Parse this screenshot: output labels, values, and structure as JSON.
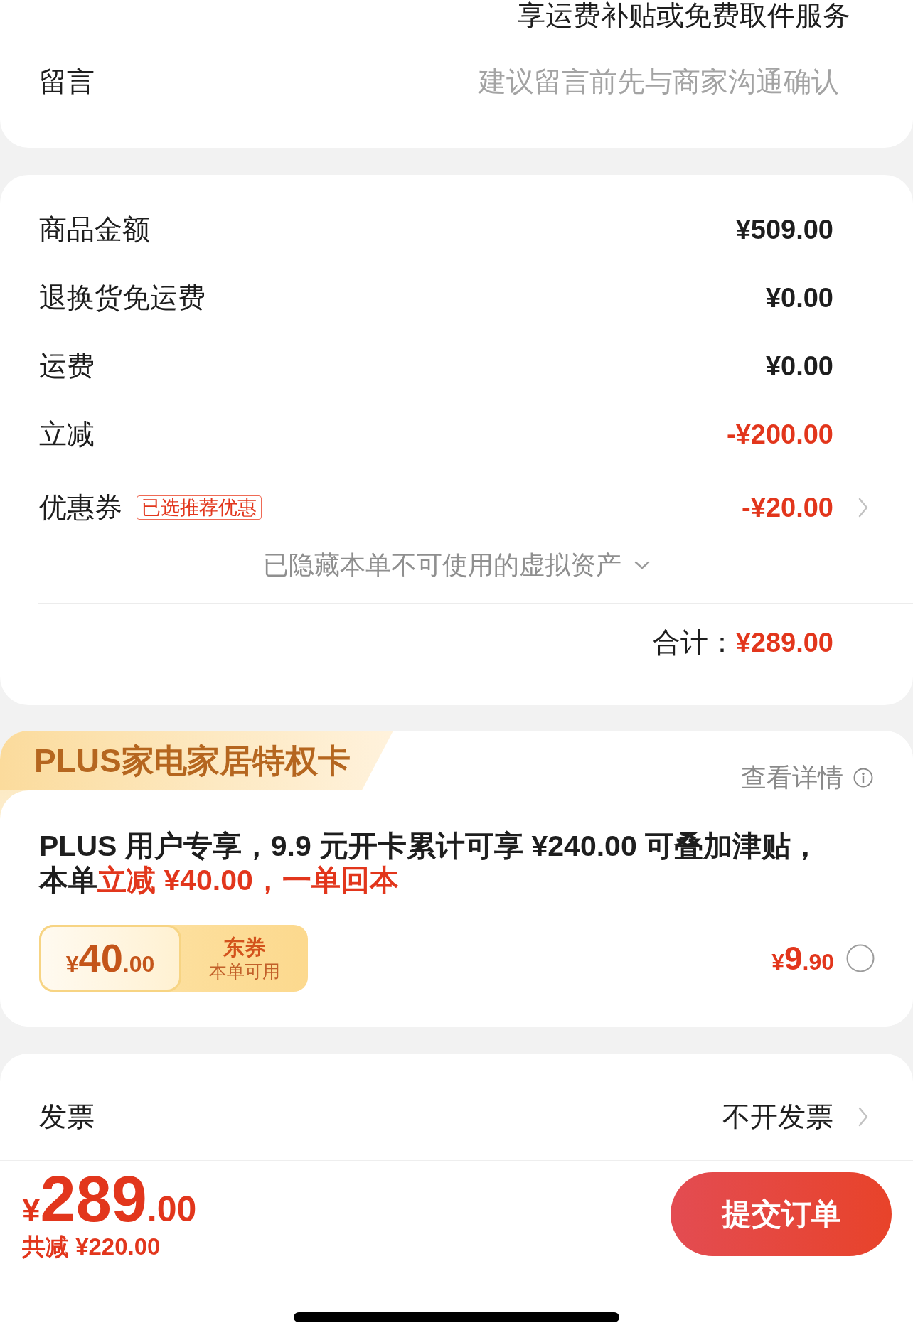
{
  "order_note": {
    "text": "享运费补贴或免费取件服务"
  },
  "message": {
    "label": "留言",
    "placeholder": "建议留言前先与商家沟通确认"
  },
  "price_summary": {
    "rows": [
      {
        "label": "商品金额",
        "value": "¥509.00",
        "kind": "amount"
      },
      {
        "label": "退换货免运费",
        "value": "¥0.00",
        "kind": "amount"
      },
      {
        "label": "运费",
        "value": "¥0.00",
        "kind": "amount"
      },
      {
        "label": "立减",
        "value": "-¥200.00",
        "kind": "discount"
      },
      {
        "label": "优惠券",
        "tag": "已选推荐优惠",
        "value": "-¥20.00",
        "kind": "selector"
      }
    ],
    "hidden_assets": {
      "text": "已隐藏本单不可使用的虚拟资产",
      "expanded": false
    },
    "total": {
      "label": "合计：",
      "value": "¥289.00"
    }
  },
  "plus_card": {
    "title": "PLUS家电家居特权卡",
    "details_link": "查看详情",
    "description_lines": [
      [
        {
          "text": "PLUS 用户专享，9.9 元开卡累计可享 ¥240.00 可叠加津贴，",
          "highlight": false
        }
      ],
      [
        {
          "text": "本单",
          "highlight": false
        },
        {
          "text": "立减 ¥40.00，一单回本",
          "highlight": true
        }
      ]
    ],
    "coupon": {
      "amount": "¥40.00",
      "name": "东券",
      "note": "本单可用"
    },
    "price": "¥9.90",
    "selected": false
  },
  "invoice": {
    "label": "发票",
    "value": "不开发票"
  },
  "checkout_bar": {
    "total": "¥289.00",
    "savings": "共减 ¥220.00",
    "submit_button": "提交订单"
  }
}
